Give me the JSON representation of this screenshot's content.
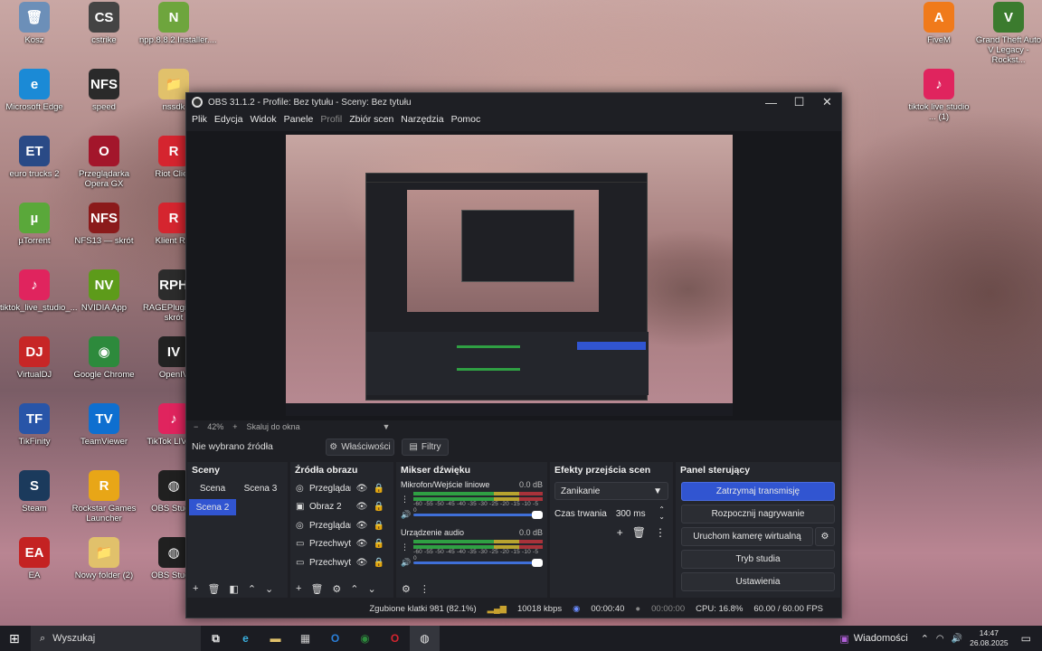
{
  "desktop": {
    "icons": [
      {
        "label": "Kosz",
        "color": "#6c8fb8",
        "glyph": "🗑"
      },
      {
        "label": "cstrike",
        "color": "#444444",
        "glyph": "CS"
      },
      {
        "label": "npp.8.8.2.Installer....",
        "color": "#6ea53d",
        "glyph": "N"
      },
      {
        "label": "Microsoft Edge",
        "color": "#1b8ad6",
        "glyph": "e"
      },
      {
        "label": "speed",
        "color": "#2a2a2a",
        "glyph": "NFS"
      },
      {
        "label": "nssdk",
        "color": "#e1c16b",
        "glyph": "📁"
      },
      {
        "label": "euro trucks 2",
        "color": "#2a4a86",
        "glyph": "ET"
      },
      {
        "label": "Przeglądarka Opera GX",
        "color": "#a3162b",
        "glyph": "O"
      },
      {
        "label": "Riot Clien",
        "color": "#d5252f",
        "glyph": "R"
      },
      {
        "label": "µTorrent",
        "color": "#5aa83a",
        "glyph": "µ"
      },
      {
        "label": "NFS13 — skrót",
        "color": "#8b1a1a",
        "glyph": "NFS"
      },
      {
        "label": "Klient Rio",
        "color": "#d5252f",
        "glyph": "R"
      },
      {
        "label": "tiktok_live_studio_...",
        "color": "#e0245e",
        "glyph": "♪"
      },
      {
        "label": "NVIDIA App",
        "color": "#5d9b1a",
        "glyph": "NV"
      },
      {
        "label": "RAGEPluginH... skrót",
        "color": "#2c2c2c",
        "glyph": "RPH"
      },
      {
        "label": "VirtualDJ",
        "color": "#c72626",
        "glyph": "DJ"
      },
      {
        "label": "Google Chrome",
        "color": "#2d8a3c",
        "glyph": "◉"
      },
      {
        "label": "OpenIV",
        "color": "#222222",
        "glyph": "IV"
      },
      {
        "label": "TikFinity",
        "color": "#2855a8",
        "glyph": "TF"
      },
      {
        "label": "TeamViewer",
        "color": "#0e6fd0",
        "glyph": "TV"
      },
      {
        "label": "TikTok LIVE S",
        "color": "#e0245e",
        "glyph": "♪"
      },
      {
        "label": "Steam",
        "color": "#1b3a5c",
        "glyph": "S"
      },
      {
        "label": "Rockstar Games Launcher",
        "color": "#e8a617",
        "glyph": "R"
      },
      {
        "label": "OBS Studio",
        "color": "#202020",
        "glyph": "◍"
      },
      {
        "label": "EA",
        "color": "#c42222",
        "glyph": "EA"
      },
      {
        "label": "Nowy folder (2)",
        "color": "#e1c16b",
        "glyph": "📁"
      },
      {
        "label": "OBS Studio",
        "color": "#202020",
        "glyph": "◍"
      },
      {
        "label": "FiveM",
        "color": "#f07a1b",
        "glyph": "A"
      },
      {
        "label": "Grand Theft Auto V Legacy - Rockst...",
        "color": "#3b7b2e",
        "glyph": "V"
      },
      {
        "label": "tiktok live studio ... (1)",
        "color": "#e0245e",
        "glyph": "♪"
      }
    ]
  },
  "obs": {
    "title": "OBS 31.1.2 - Profile: Bez tytułu - Sceny: Bez tytułu",
    "menu": [
      "Plik",
      "Edycja",
      "Widok",
      "Panele",
      "Profil",
      "Zbiór scen",
      "Narzędzia",
      "Pomoc"
    ],
    "zoom": {
      "minus": "−",
      "value": "42%",
      "plus": "+",
      "mode": "Skaluj do okna"
    },
    "source_bar": {
      "no_source": "Nie wybrano źródła",
      "properties": "Właściwości",
      "filters": "Filtry"
    },
    "scenes": {
      "title": "Sceny",
      "items": [
        "Scena",
        "Scena 3",
        "Scena 2"
      ]
    },
    "sources": {
      "title": "Źródła obrazu",
      "items": [
        {
          "name": "Przeglądarka",
          "icon": "globe-icon"
        },
        {
          "name": "Obraz 2",
          "icon": "image-icon"
        },
        {
          "name": "Przeglądarka",
          "icon": "globe-icon"
        },
        {
          "name": "Przechwytywanie",
          "icon": "monitor-icon"
        },
        {
          "name": "Przechwytywanie",
          "icon": "monitor-icon"
        }
      ]
    },
    "mixer": {
      "title": "Mikser dźwięku",
      "channels": [
        {
          "name": "Mikrofon/Wejście liniowe",
          "db": "0.0 dB"
        },
        {
          "name": "Urządzenie audio",
          "db": "0.0 dB"
        }
      ],
      "ticks": "-60 -55 -50 -45 -40 -35 -30 -25 -20 -15 -10 -5 0"
    },
    "transitions": {
      "title": "Efekty przejścia scen",
      "selected": "Zanikanie",
      "duration_label": "Czas trwania",
      "duration_value": "300 ms"
    },
    "controls": {
      "title": "Panel sterujący",
      "stop_stream": "Zatrzymaj transmisję",
      "start_record": "Rozpocznij nagrywanie",
      "virtual_cam": "Uruchom kamerę wirtualną",
      "studio_mode": "Tryb studia",
      "settings": "Ustawienia"
    },
    "status": {
      "dropped": "Zgubione klatki 981 (82.1%)",
      "bitrate": "10018 kbps",
      "stream_time": "00:00:40",
      "record_time": "00:00:00",
      "cpu": "CPU: 16.8%",
      "fps": "60.00 / 60.00 FPS"
    }
  },
  "taskbar": {
    "search_placeholder": "Wyszukaj",
    "news": "Wiadomości",
    "time": "14:47",
    "date": "26.08.2025"
  },
  "colors": {
    "accent": "#3155d1",
    "meter_green": "#2fa043",
    "meter_yellow": "#b8a32f",
    "meter_red": "#a8323a"
  }
}
